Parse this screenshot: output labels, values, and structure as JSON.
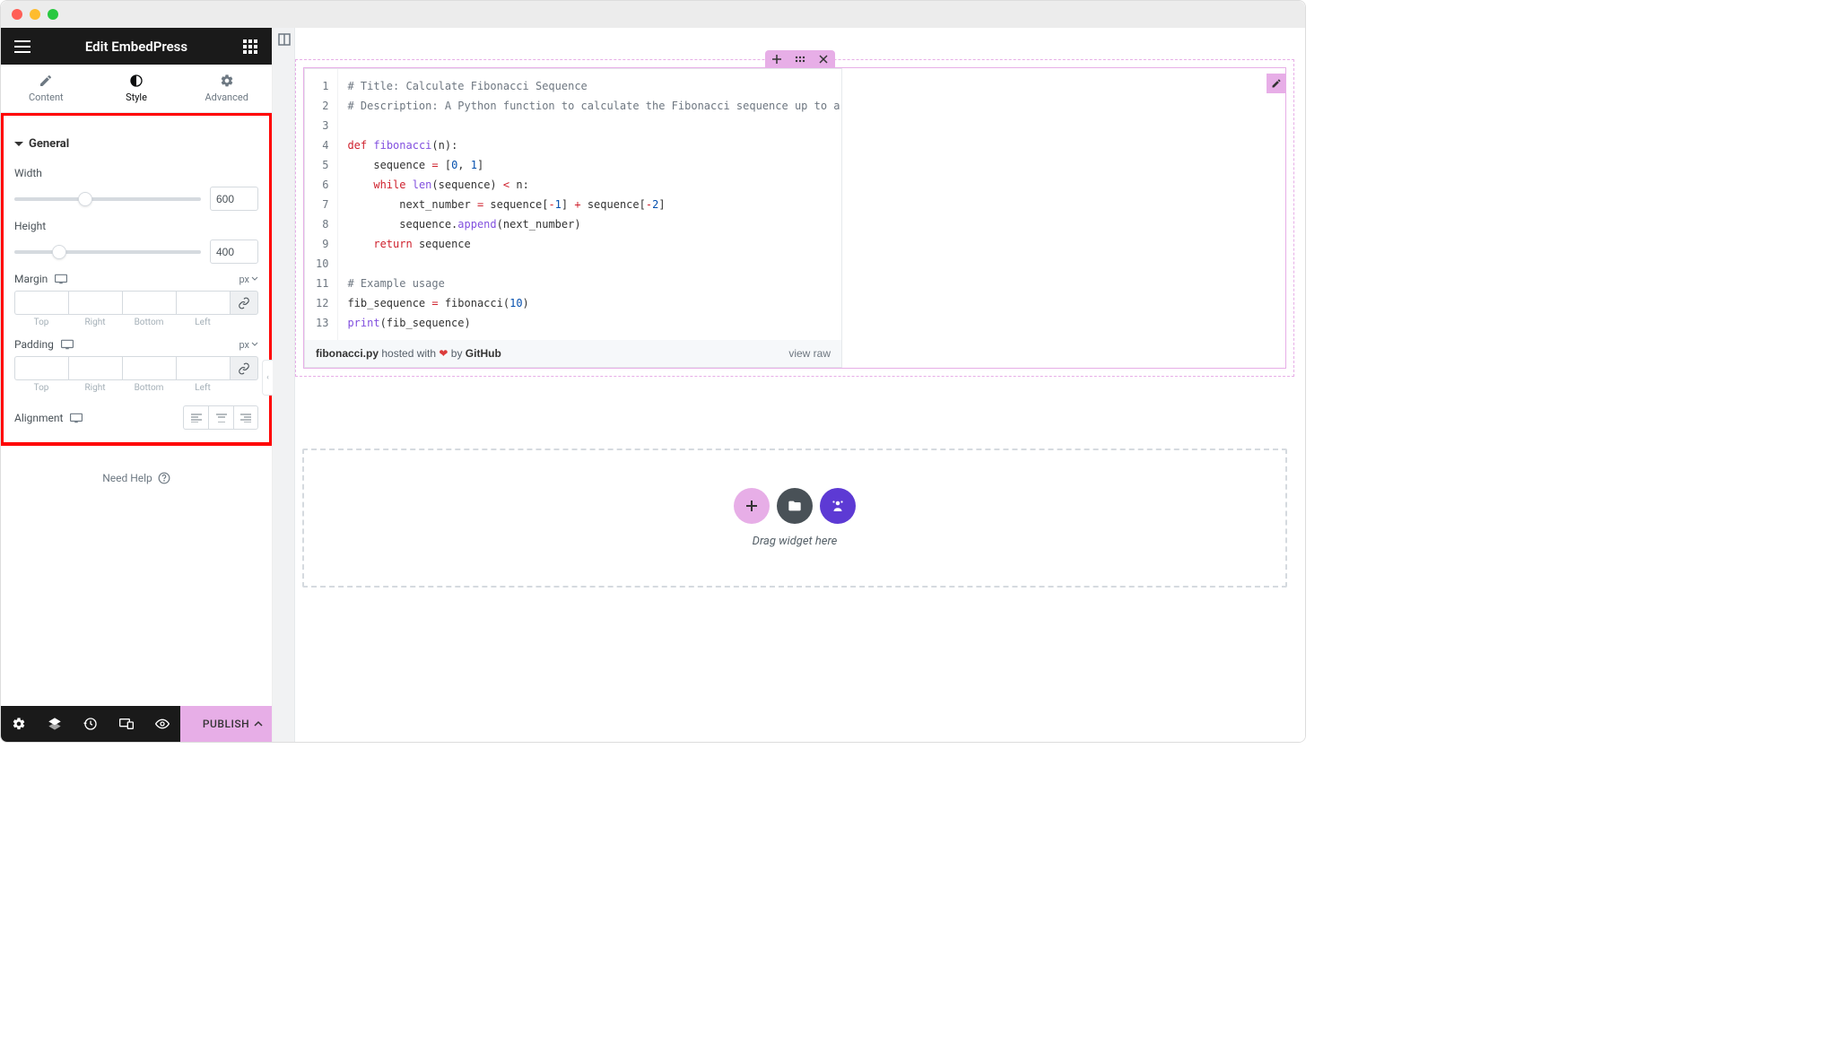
{
  "header": {
    "title": "Edit EmbedPress"
  },
  "tabs": {
    "content": "Content",
    "style": "Style",
    "advanced": "Advanced"
  },
  "section": {
    "general": {
      "title": "General",
      "width_label": "Width",
      "width_value": "600",
      "height_label": "Height",
      "height_value": "400",
      "margin_label": "Margin",
      "padding_label": "Padding",
      "unit": "px",
      "sublabels": {
        "top": "Top",
        "right": "Right",
        "bottom": "Bottom",
        "left": "Left"
      },
      "alignment_label": "Alignment"
    }
  },
  "need_help": "Need Help",
  "bottom": {
    "publish": "PUBLISH"
  },
  "code": {
    "lines": [
      "# Title: Calculate Fibonacci Sequence",
      "# Description: A Python function to calculate the Fibonacci sequence up to a",
      "",
      "def fibonacci(n):",
      "    sequence = [0, 1]",
      "    while len(sequence) < n:",
      "        next_number = sequence[-1] + sequence[-2]",
      "        sequence.append(next_number)",
      "    return sequence",
      "",
      "# Example usage",
      "fib_sequence = fibonacci(10)",
      "print(fib_sequence)"
    ],
    "filename": "fibonacci.py",
    "hosted": " hosted with ",
    "by": " by ",
    "github": "GitHub",
    "view_raw": "view raw"
  },
  "dropzone": {
    "label": "Drag widget here"
  }
}
